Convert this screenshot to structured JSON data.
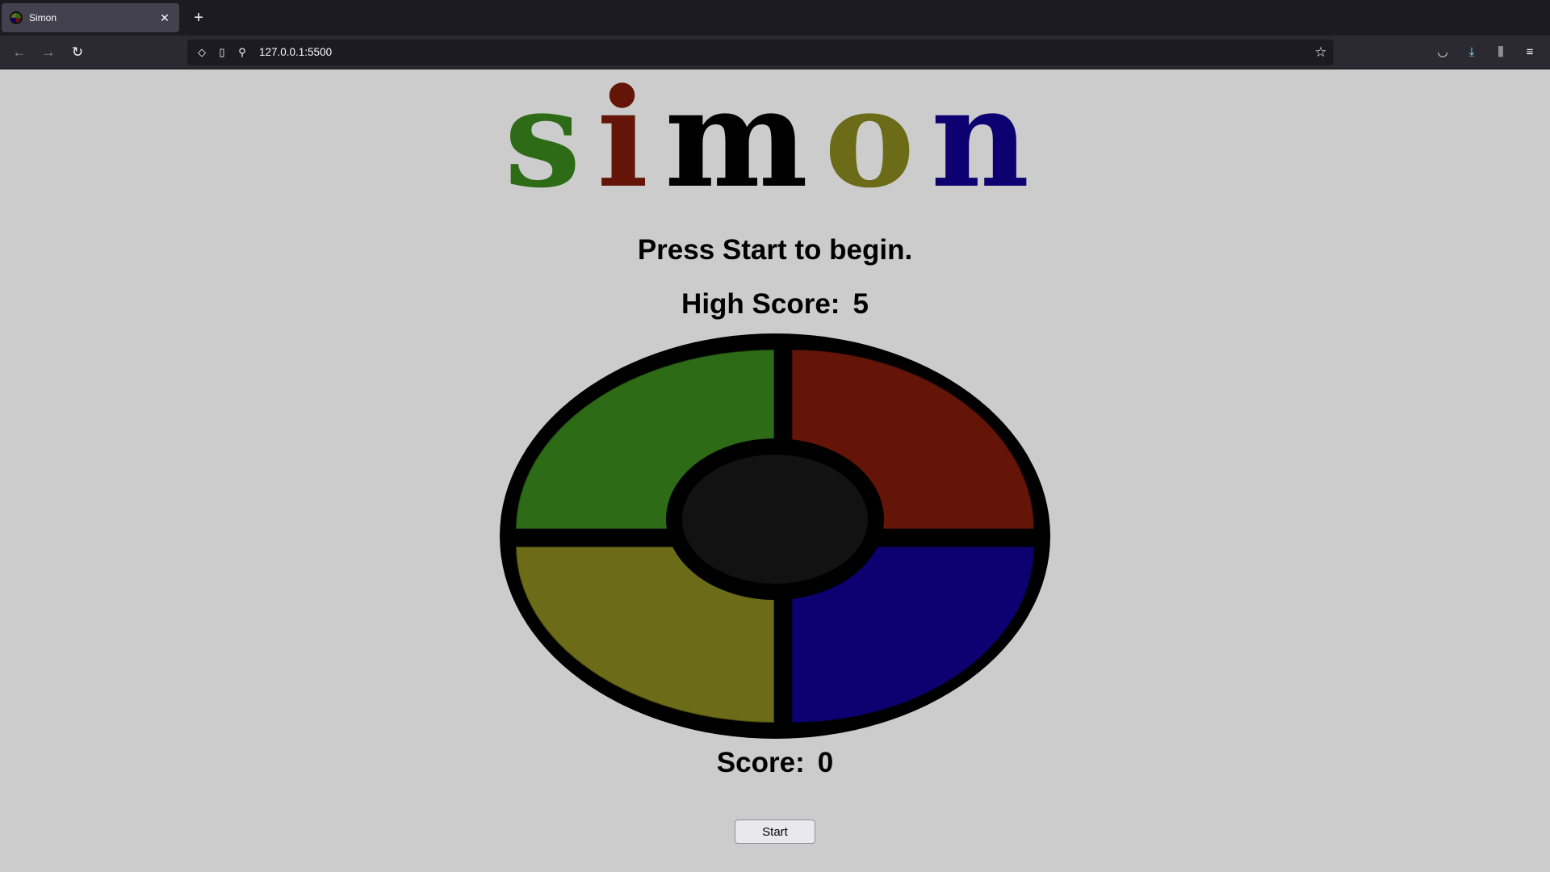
{
  "browser": {
    "tab": {
      "title": "Simon",
      "close": "✕",
      "favicon": "simon-favicon"
    },
    "new_tab": "+",
    "nav": {
      "back": "←",
      "forward": "→",
      "reload": "↻"
    },
    "url": "127.0.0.1:5500",
    "icons": {
      "shield": "◇",
      "page": "▯",
      "permissions": "⚲",
      "bookmark": "☆",
      "pocket": "◡",
      "downloads": "⤓",
      "library": "⫼",
      "menu": "≡"
    }
  },
  "logo": {
    "letters": [
      {
        "char": "s",
        "color": "#2e6b16"
      },
      {
        "char": "i",
        "color": "#641508"
      },
      {
        "char": "m",
        "color": "#000000"
      },
      {
        "char": "o",
        "color": "#6b6b18"
      },
      {
        "char": "n",
        "color": "#0d0070"
      }
    ]
  },
  "message": "Press Start to begin.",
  "high_score": {
    "label": "High Score:",
    "value": "5"
  },
  "score": {
    "label": "Score:",
    "value": "0"
  },
  "board": {
    "colors": {
      "green": "#2e6b16",
      "red": "#641508",
      "yellow": "#6b6b18",
      "blue": "#0d0070"
    }
  },
  "start_button": "Start"
}
